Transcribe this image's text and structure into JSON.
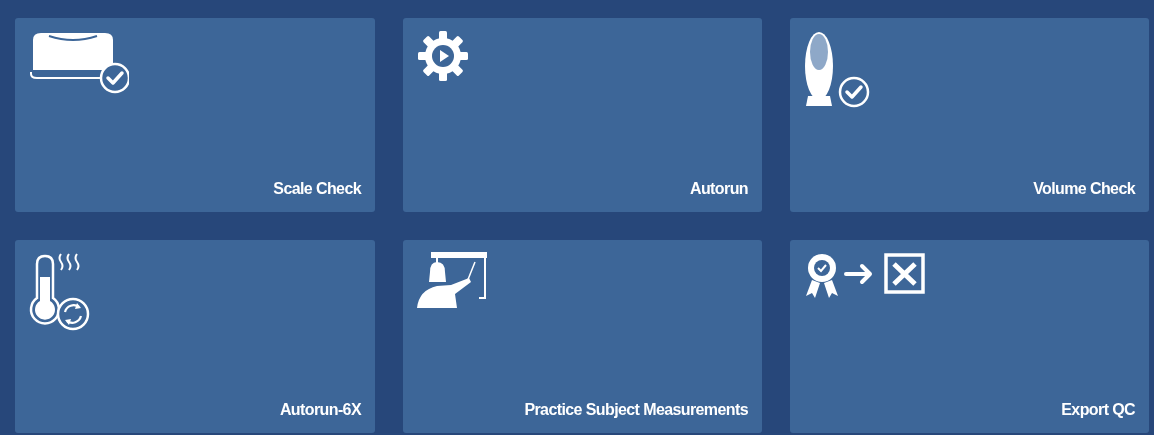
{
  "tiles": [
    {
      "label": "Scale Check",
      "kind": "scale-check"
    },
    {
      "label": "Autorun",
      "kind": "gear-play"
    },
    {
      "label": "Volume Check",
      "kind": "device-check"
    },
    {
      "label": "Autorun-6X",
      "kind": "thermometer-cycle"
    },
    {
      "label": "Practice Subject Measurements",
      "kind": "presenter"
    },
    {
      "label": "Export QC",
      "kind": "export-spreadsheet"
    }
  ]
}
